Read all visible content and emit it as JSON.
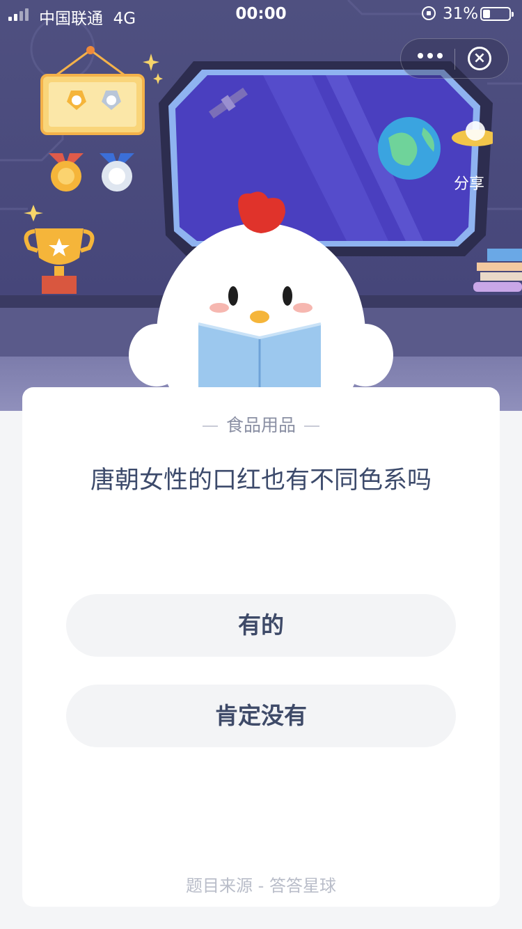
{
  "status_bar": {
    "carrier": "中国联通",
    "network": "4G",
    "time": "00:00",
    "battery_percent": "31%"
  },
  "header": {
    "share_label": "分享",
    "more_icon": "more-dots-icon",
    "close_icon": "close-circle-icon"
  },
  "question_card": {
    "category": "食品用品",
    "question": "唐朝女性的口红也有不同色系吗",
    "options": [
      {
        "label": "有的"
      },
      {
        "label": "肯定没有"
      }
    ],
    "source": "题目来源 - 答答星球"
  },
  "colors": {
    "scene_background": "#4a4a78",
    "window_glass": "#4a3fbf",
    "card_background": "#ffffff",
    "option_background": "#f3f4f6",
    "question_text": "#3c4a6b"
  }
}
